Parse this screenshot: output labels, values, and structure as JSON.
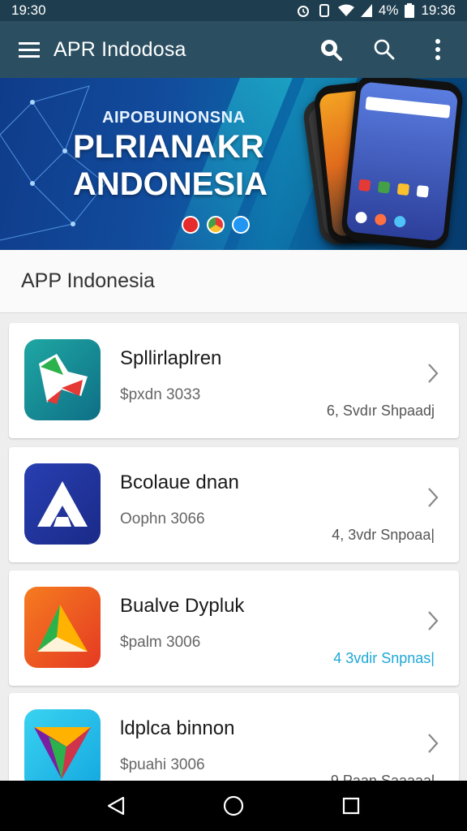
{
  "status_bar": {
    "time_left": "19:30",
    "time_right": "19:36",
    "battery_pct": "4%"
  },
  "app_bar": {
    "title": "APR Indodosa",
    "icons": [
      "menu-icon",
      "magnify-badge-icon",
      "search-icon",
      "more-vert-icon"
    ]
  },
  "banner": {
    "eyebrow": "AIPOBUINONSNA",
    "headline_line1": "PLRIANAKR",
    "headline_line2": "ANDONESIA",
    "colors": {
      "bg_start": "#0f3c8a",
      "bg_end": "#073a6c",
      "accent": "#28d2dc"
    }
  },
  "section": {
    "title": "APP Indonesia"
  },
  "apps": [
    {
      "name": "Spllirlaplren",
      "meta": "$pxdn 3033",
      "size": "6, Svdır Shpaadj",
      "size_accent": false,
      "icon": "bird-app-icon"
    },
    {
      "name": "Bcolaue dnan",
      "meta": "Oophn 3066",
      "size": "4, 3vdr Snpoaa|",
      "size_accent": false,
      "icon": "letter-a-app-icon"
    },
    {
      "name": "Bualve Dypluk",
      "meta": "$palm 3006",
      "size": "4 3vdir Snpnas|",
      "size_accent": true,
      "icon": "triangle-arrow-app-icon"
    },
    {
      "name": "ldplca binnon",
      "meta": "$puahi 3006",
      "size": "9 Paan Saaaaal",
      "size_accent": false,
      "icon": "prism-app-icon"
    }
  ],
  "nav": [
    "back-icon",
    "home-icon",
    "recents-icon"
  ]
}
